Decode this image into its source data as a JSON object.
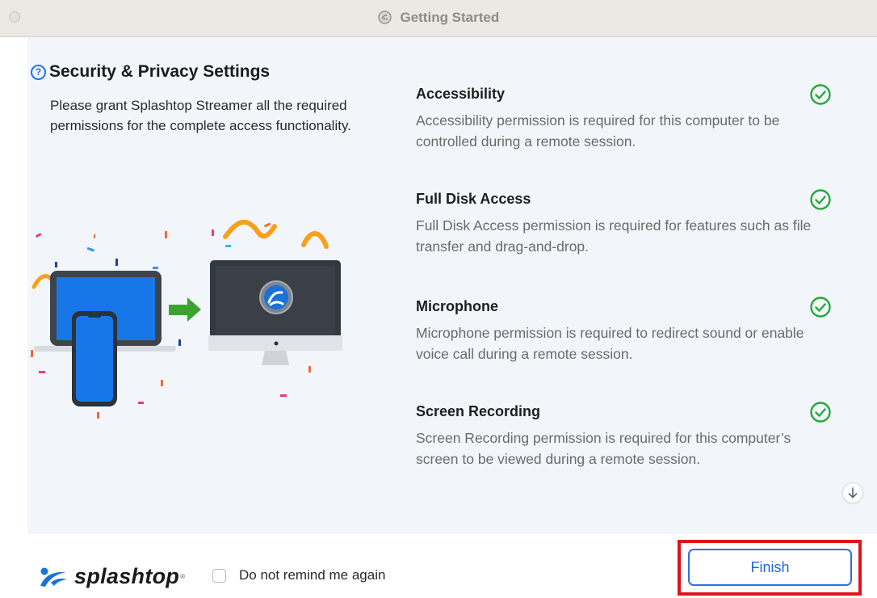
{
  "window": {
    "title": "Getting Started"
  },
  "intro": {
    "heading": "Security & Privacy Settings",
    "text": "Please grant Splashtop Streamer all the required permissions for the complete access functionality."
  },
  "permissions": [
    {
      "title": "Accessibility",
      "description": "Accessibility permission is required for this computer to be controlled during a remote session.",
      "status": "granted"
    },
    {
      "title": "Full Disk Access",
      "description": "Full Disk Access permission is required for features such as file transfer and drag-and-drop.",
      "status": "granted"
    },
    {
      "title": "Microphone",
      "description": "Microphone permission is required to redirect sound or enable voice call during a remote session.",
      "status": "granted"
    },
    {
      "title": "Screen Recording",
      "description": "Screen Recording permission is required for this computer’s screen to be viewed during a remote session.",
      "status": "granted"
    }
  ],
  "footer": {
    "brand": "splashtop",
    "brand_mark": "®",
    "remind_label": "Do not remind me again",
    "remind_checked": false,
    "finish_label": "Finish"
  },
  "colors": {
    "accent": "#1f6fe5",
    "check": "#27a83a",
    "highlight": "#e0141b",
    "panel": "#f2f6fb"
  },
  "icons": {
    "window": "splashtop-icon",
    "help": "question-circle-icon",
    "status": "check-circle-icon",
    "scroll": "arrow-down-icon"
  }
}
